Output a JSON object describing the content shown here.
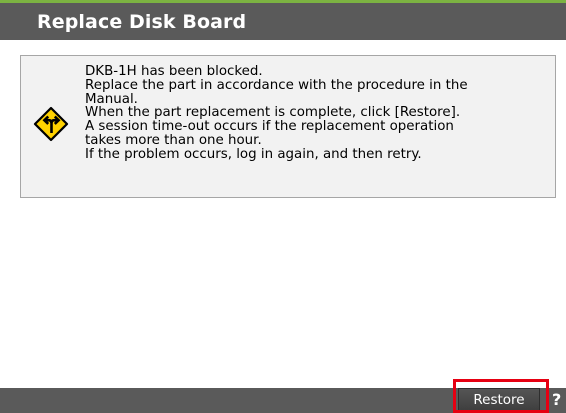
{
  "dialog": {
    "title": "Replace Disk Board"
  },
  "message": {
    "icon": "warning-icon",
    "lines": [
      "DKB-1H has been blocked.",
      "Replace the part in accordance with the procedure in the",
      "Manual.",
      "When the part replacement is complete, click [Restore].",
      "A session time-out occurs if the replacement operation",
      "takes more than one hour.",
      "If the problem occurs, log in again, and then retry."
    ]
  },
  "footer": {
    "restore_label": "Restore",
    "help_label": "?"
  },
  "colors": {
    "title_bar": "#5a5a5a",
    "accent_line": "#7cb342",
    "highlight": "#e60012",
    "icon_yellow": "#ffd200"
  }
}
